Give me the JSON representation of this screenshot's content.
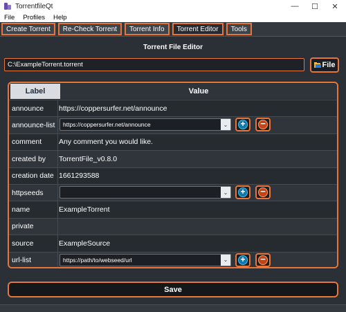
{
  "window": {
    "title": "TorrentfileQt",
    "controls": {
      "minimize": "—",
      "maximize": "☐",
      "close": "✕"
    }
  },
  "menu": [
    "File",
    "Profiles",
    "Help"
  ],
  "tabs": [
    {
      "label": "Create Torrent",
      "active": false
    },
    {
      "label": "Re-Check Torrent",
      "active": false
    },
    {
      "label": "Torrent Info",
      "active": false
    },
    {
      "label": "Torrent Editor",
      "active": true
    },
    {
      "label": "Tools",
      "active": false
    }
  ],
  "editor": {
    "title": "Torrent File Editor",
    "path_value": "C:\\ExampleTorrent.torrent",
    "file_button": "File"
  },
  "table": {
    "headers": {
      "label": "Label",
      "value": "Value"
    },
    "rows": [
      {
        "label": "announce",
        "value": "https://coppersurfer.net/announce",
        "type": "text"
      },
      {
        "label": "announce-list",
        "value": "https://coppersurfer.net/announce",
        "type": "combo"
      },
      {
        "label": "comment",
        "value": "Any comment you would like.",
        "type": "text"
      },
      {
        "label": "created by",
        "value": "TorrentFile_v0.8.0",
        "type": "text"
      },
      {
        "label": "creation date",
        "value": "1661293588",
        "type": "text"
      },
      {
        "label": "httpseeds",
        "value": "",
        "type": "combo"
      },
      {
        "label": "name",
        "value": "ExampleTorrent",
        "type": "text"
      },
      {
        "label": "private",
        "value": "",
        "type": "text"
      },
      {
        "label": "source",
        "value": "ExampleSource",
        "type": "text"
      },
      {
        "label": "url-list",
        "value": "https://path/to/webseed/url",
        "type": "combo"
      }
    ]
  },
  "save_button": "Save",
  "colors": {
    "accent": "#e8763a",
    "background": "#2b3036",
    "plus": "#1478a8",
    "minus": "#c4441a"
  },
  "icons": {
    "app": "app-icon",
    "file": "folder-icon",
    "add": "plus-circle-icon",
    "remove": "minus-circle-icon",
    "dropdown": "chevron-down-icon"
  }
}
